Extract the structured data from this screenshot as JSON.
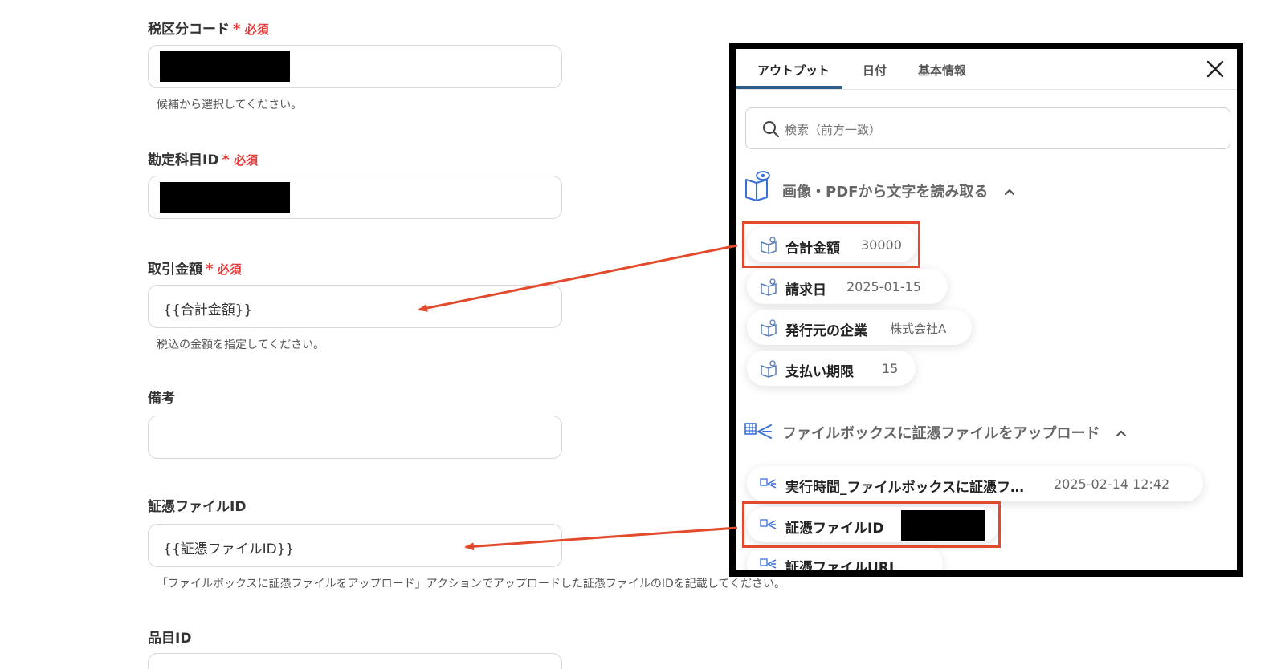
{
  "form": {
    "tax_code": {
      "label": "税区分コード",
      "required": "必須",
      "hint": "候補から選択してください。"
    },
    "account_id": {
      "label": "勘定科目ID",
      "required": "必須"
    },
    "amount": {
      "label": "取引金額",
      "required": "必須",
      "value": "{{合計金額}}",
      "hint": "税込の金額を指定してください。"
    },
    "memo": {
      "label": "備考",
      "value": ""
    },
    "voucher_id": {
      "label": "証憑ファイルID",
      "value": "{{証憑ファイルID}}",
      "hint": "「ファイルボックスに証憑ファイルをアップロード」アクションでアップロードした証憑ファイルのIDを記載してください。"
    },
    "item_id": {
      "label": "品目ID"
    },
    "required_mark": "*"
  },
  "panel": {
    "tabs": [
      "アウトプット",
      "日付",
      "基本情報"
    ],
    "active_tab": 0,
    "search_placeholder": "検索（前方一致）",
    "section1": {
      "title": "画像・PDFから文字を読み取る",
      "items": [
        {
          "key": "合計金額",
          "value": "30000"
        },
        {
          "key": "請求日",
          "value": "2025-01-15"
        },
        {
          "key": "発行元の企業",
          "value": "株式会社A"
        },
        {
          "key": "支払い期限",
          "value": "15"
        }
      ]
    },
    "section2": {
      "title": "ファイルボックスに証憑ファイルをアップロード",
      "items": [
        {
          "key": "実行時間_ファイルボックスに証憑フ…",
          "value": "2025-02-14 12:42"
        },
        {
          "key": "証憑ファイルID",
          "value": ""
        },
        {
          "key": "証憑ファイルURL",
          "value": ""
        }
      ]
    }
  },
  "colors": {
    "accent": "#2d5d8a",
    "required": "#e53b3b",
    "highlight": "#e24a2c",
    "icon_blue": "#3a6fd8"
  }
}
